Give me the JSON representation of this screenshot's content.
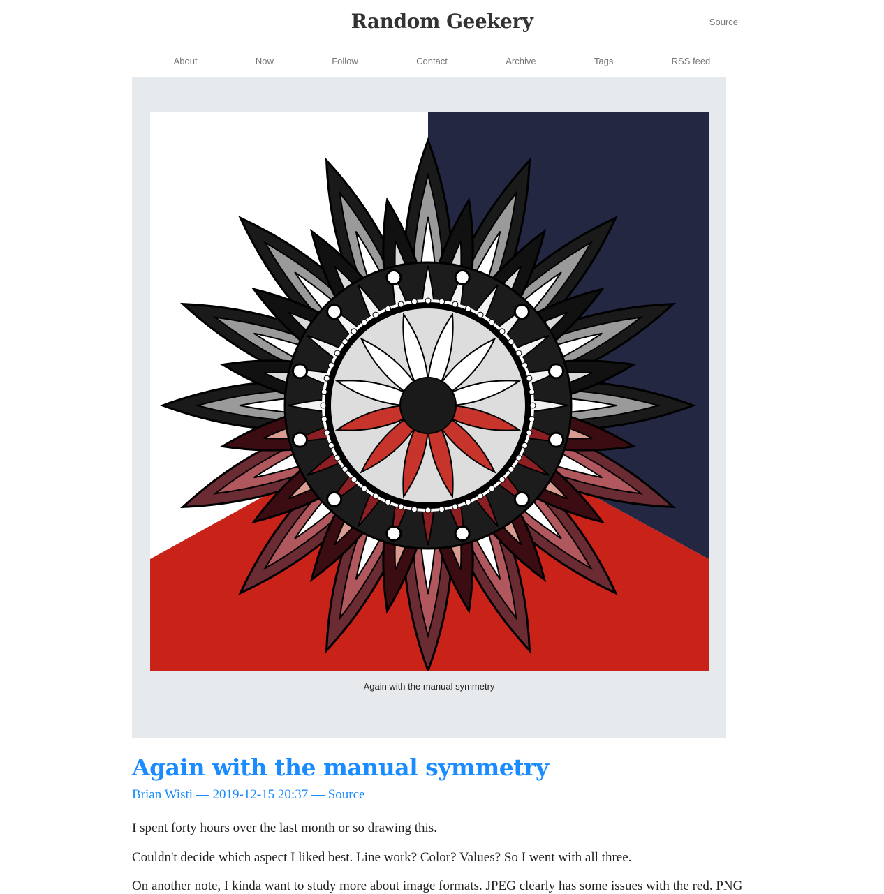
{
  "header": {
    "site_title": "Random Geekery",
    "source_link": "Source"
  },
  "nav": {
    "items": [
      "About",
      "Now",
      "Follow",
      "Contact",
      "Archive",
      "Tags",
      "RSS feed"
    ]
  },
  "figure": {
    "caption": "Again with the manual symmetry",
    "colors": {
      "background": "#e7eaed",
      "navy": "#232742",
      "red": "#c82219"
    }
  },
  "post": {
    "title": "Again with the manual symmetry",
    "author": "Brian Wisti",
    "date": "2019-12-15 20:37",
    "source_link": "Source",
    "separator": "—",
    "paragraphs": [
      "I spent forty hours over the last month or so drawing this.",
      "Couldn't decide which aspect I liked best. Line work? Color? Values? So I went with all three.",
      "On another note, I kinda want to study more about image formats. JPEG clearly has some issues with the red. PNG"
    ]
  },
  "colors": {
    "link": "#1a8cff",
    "muted": "#777777"
  }
}
